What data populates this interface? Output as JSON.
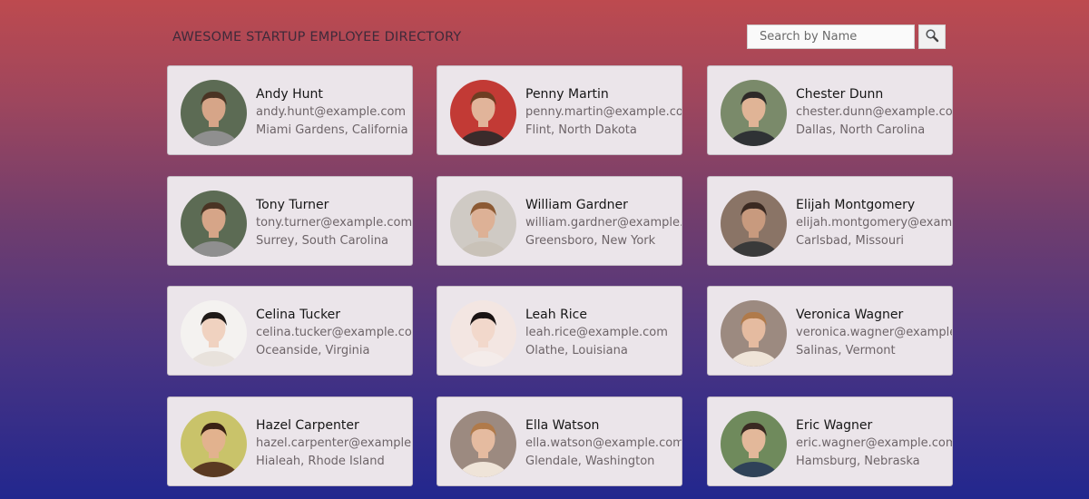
{
  "header": {
    "title": "AWESOME STARTUP EMPLOYEE DIRECTORY"
  },
  "search": {
    "placeholder": "Search by Name",
    "button_icon": "magnifier-icon"
  },
  "employees": [
    {
      "name": "Andy Hunt",
      "email": "andy.hunt@example.com",
      "location": "Miami Gardens, California",
      "bg": "#5c6b54",
      "skin": "#d6a588",
      "hair": "#4a3424",
      "shirt": "#8f8f8f"
    },
    {
      "name": "Penny Martin",
      "email": "penny.martin@example.com",
      "location": "Flint, North Dakota",
      "bg": "#c23a35",
      "skin": "#e1b49a",
      "hair": "#6e3d22",
      "shirt": "#3a2b2b"
    },
    {
      "name": "Chester Dunn",
      "email": "chester.dunn@example.com",
      "location": "Dallas, North Carolina",
      "bg": "#7a8a6a",
      "skin": "#e0b496",
      "hair": "#2e2a28",
      "shirt": "#2f3235"
    },
    {
      "name": "Tony Turner",
      "email": "tony.turner@example.com",
      "location": "Surrey, South Carolina",
      "bg": "#5c6b54",
      "skin": "#d6a588",
      "hair": "#4a3424",
      "shirt": "#8f8f8f"
    },
    {
      "name": "William Gardner",
      "email": "william.gardner@example.com",
      "location": "Greensboro, New York",
      "bg": "#cfcac4",
      "skin": "#ddb196",
      "hair": "#8c5a34",
      "shirt": "#c9c2b8"
    },
    {
      "name": "Elijah Montgomery",
      "email": "elijah.montgomery@example.com",
      "location": "Carlsbad, Missouri",
      "bg": "#8a7466",
      "skin": "#c89a7e",
      "hair": "#3b2a22",
      "shirt": "#3a3a3a"
    },
    {
      "name": "Celina Tucker",
      "email": "celina.tucker@example.com",
      "location": "Oceanside, Virginia",
      "bg": "#f4f2f0",
      "skin": "#f0d2c0",
      "hair": "#1f1a18",
      "shirt": "#e8e2dc"
    },
    {
      "name": "Leah Rice",
      "email": "leah.rice@example.com",
      "location": "Olathe, Louisiana",
      "bg": "#f3e6e2",
      "skin": "#f2d8cb",
      "hair": "#1a1414",
      "shirt": "#f4ecea"
    },
    {
      "name": "Veronica Wagner",
      "email": "veronica.wagner@example.com",
      "location": "Salinas, Vermont",
      "bg": "#9c8a80",
      "skin": "#e5bba0",
      "hair": "#b07a4a",
      "shirt": "#efe4d8"
    },
    {
      "name": "Hazel Carpenter",
      "email": "hazel.carpenter@example.com",
      "location": "Hialeah, Rhode Island",
      "bg": "#c9c36a",
      "skin": "#e2b28e",
      "hair": "#3a2214",
      "shirt": "#5a3a22"
    },
    {
      "name": "Ella Watson",
      "email": "ella.watson@example.com",
      "location": "Glendale, Washington",
      "bg": "#9c8a80",
      "skin": "#e5bba0",
      "hair": "#b07a4a",
      "shirt": "#efe4d8"
    },
    {
      "name": "Eric Wagner",
      "email": "eric.wagner@example.com",
      "location": "Hamsburg, Nebraska",
      "bg": "#6f8a5c",
      "skin": "#e3b89a",
      "hair": "#3a2a22",
      "shirt": "#2f4258"
    }
  ]
}
